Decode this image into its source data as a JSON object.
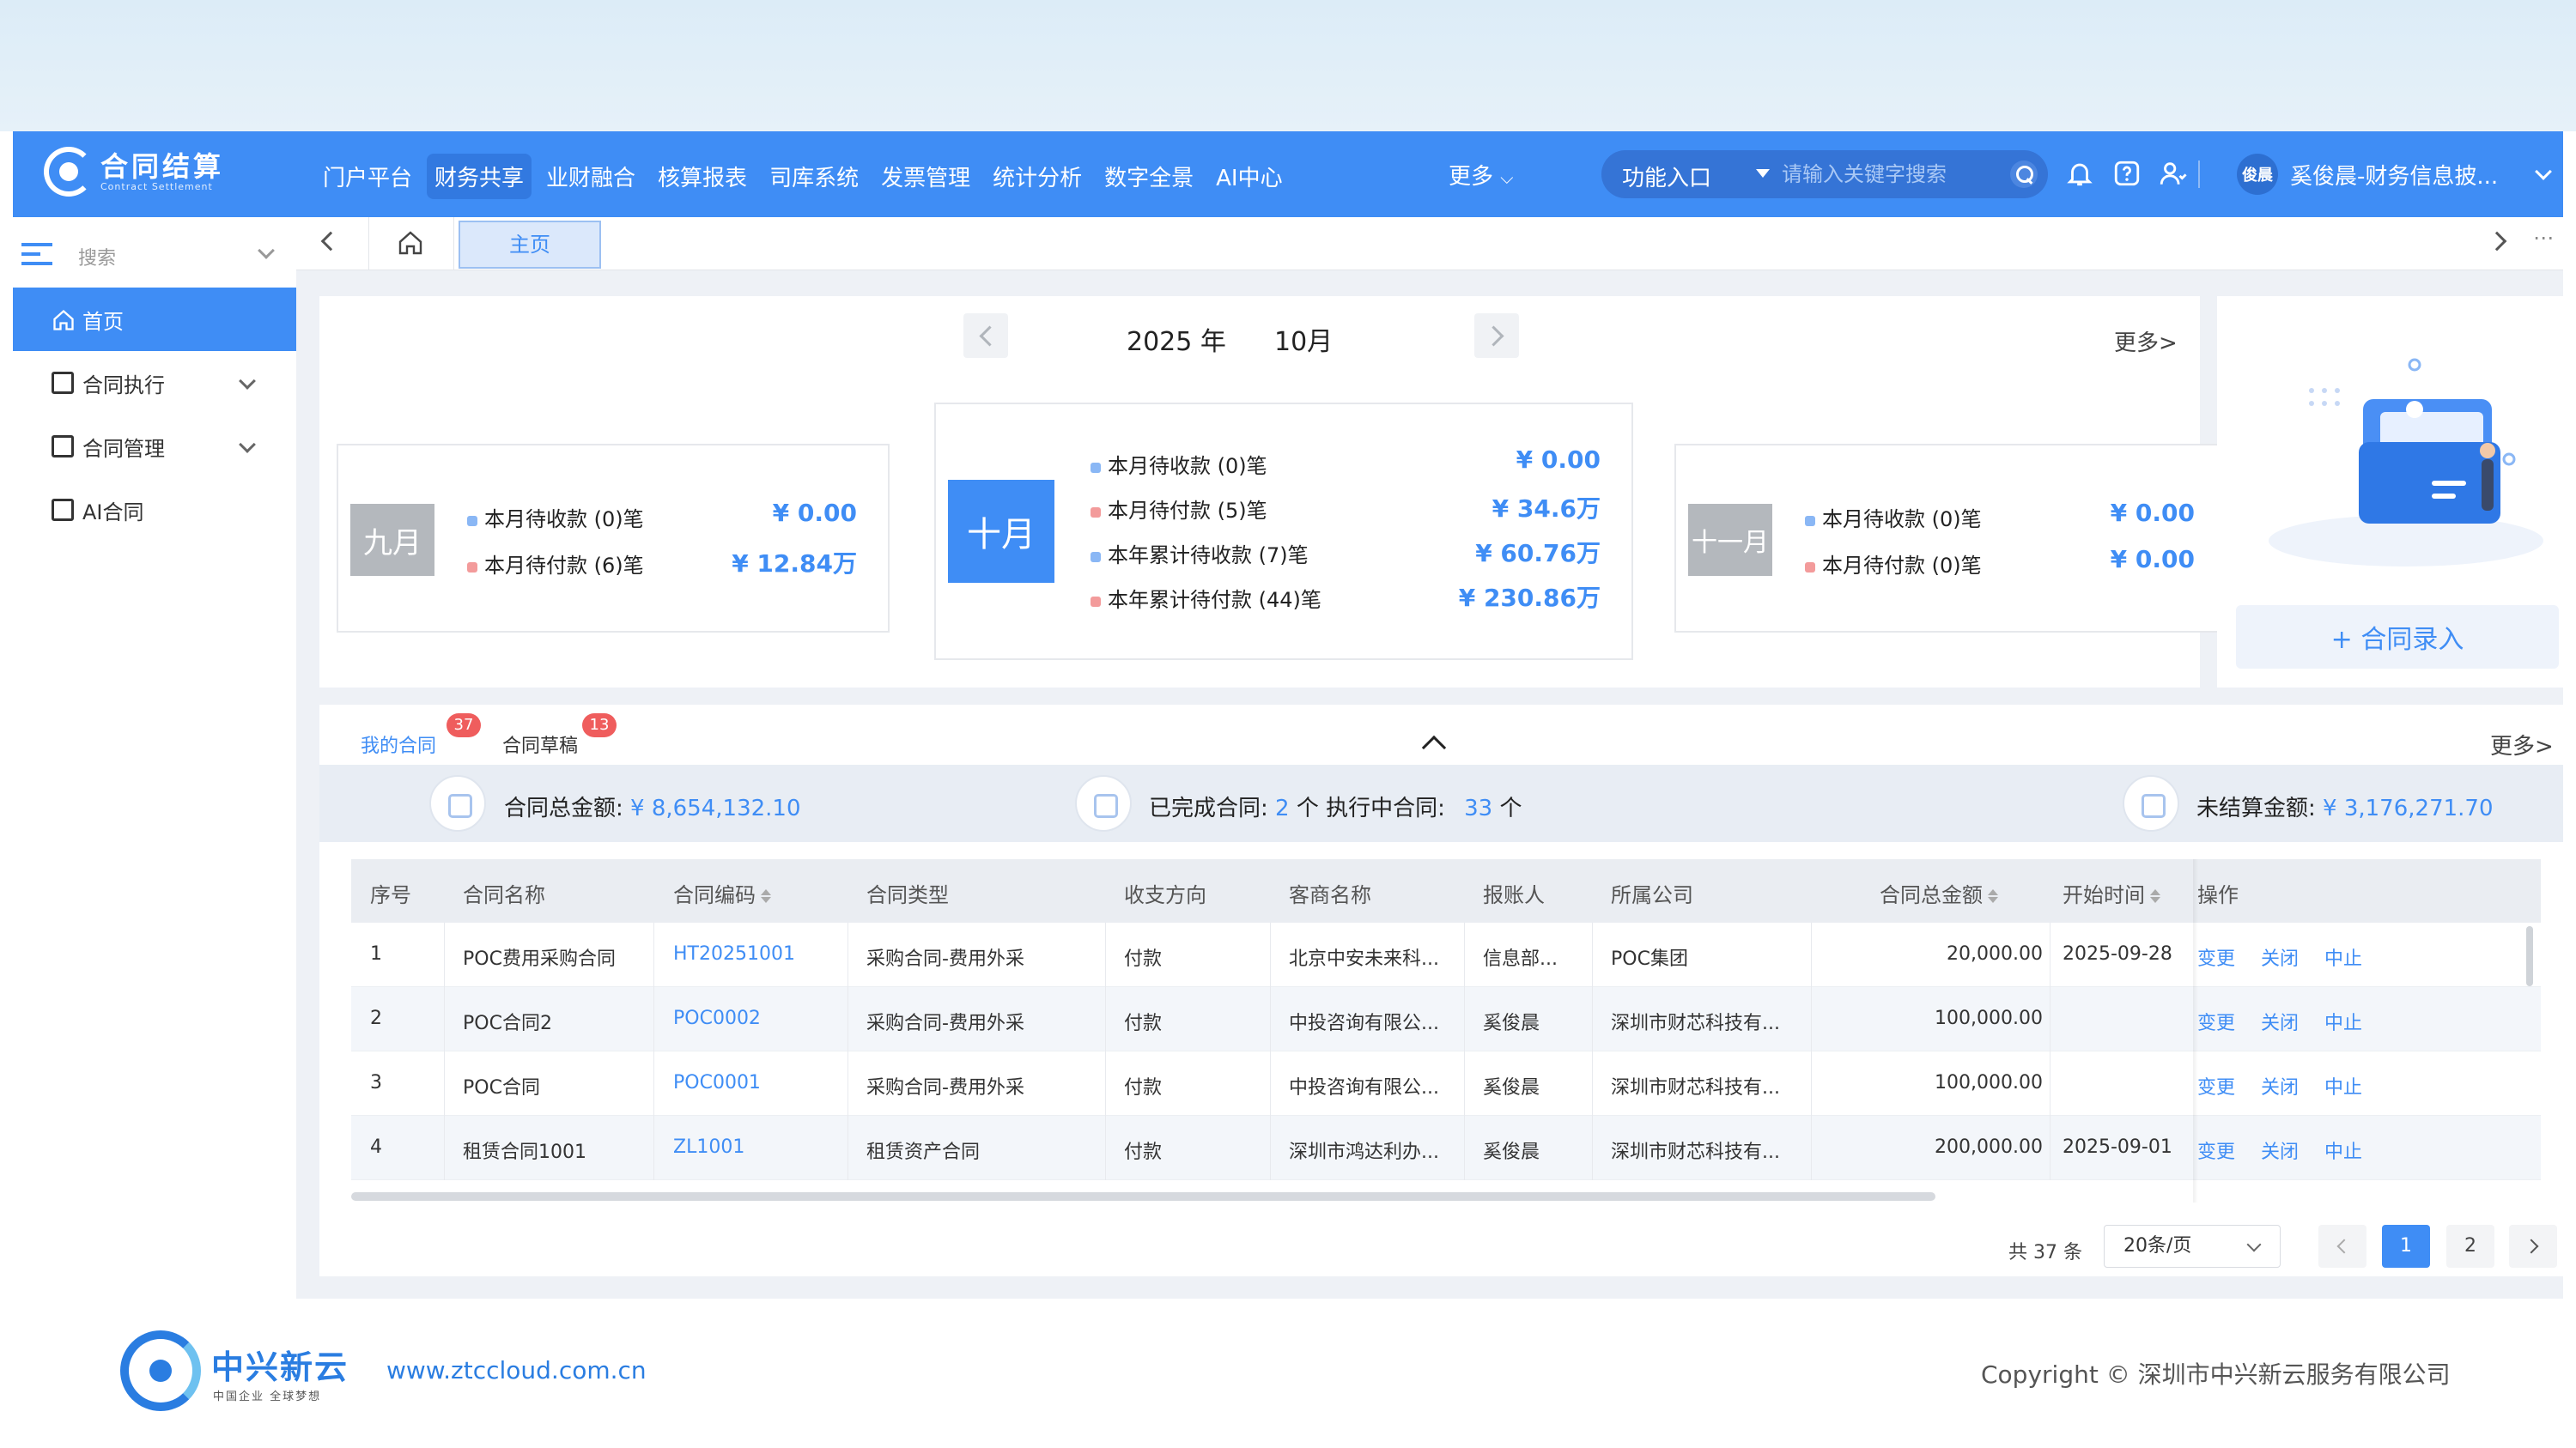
{
  "app": {
    "logo_cn": "合同结算",
    "logo_en": "Contract Settlement",
    "colors": {
      "primary": "#3f8df5",
      "badge": "#ef5d5d",
      "muted_month": "#b4b8bd"
    }
  },
  "header": {
    "nav": [
      "门户平台",
      "财务共享",
      "业财融合",
      "核算报表",
      "司库系统",
      "发票管理",
      "统计分析",
      "数字全景",
      "AI中心"
    ],
    "active_nav": "财务共享",
    "more": "更多",
    "func_label": "功能入口",
    "search_placeholder": "请输入关键字搜索",
    "avatar": "俊晨",
    "user": "奚俊晨-财务信息披..."
  },
  "sidebar": {
    "search_label": "搜索",
    "items": [
      {
        "label": "首页"
      },
      {
        "label": "合同执行"
      },
      {
        "label": "合同管理"
      },
      {
        "label": "AI合同"
      }
    ]
  },
  "tabs": {
    "main": "主页"
  },
  "calendar": {
    "year": "2025 年",
    "month": "10月",
    "more": "更多>",
    "prev_month": {
      "label": "九月",
      "rows": [
        {
          "text": "本月待收款 (0)笔",
          "value": "¥ 0.00"
        },
        {
          "text": "本月待付款 (6)笔",
          "value": "¥ 12.84万"
        }
      ]
    },
    "current_month": {
      "label": "十月",
      "rows": [
        {
          "text": "本月待收款 (0)笔",
          "value": "¥ 0.00"
        },
        {
          "text": "本月待付款 (5)笔",
          "value": "¥ 34.6万"
        },
        {
          "text": "本年累计待收款 (7)笔",
          "value": "¥ 60.76万"
        },
        {
          "text": "本年累计待付款 (44)笔",
          "value": "¥ 230.86万"
        }
      ]
    },
    "next_month": {
      "label": "十一月",
      "rows": [
        {
          "text": "本月待收款 (0)笔",
          "value": "¥ 0.00"
        },
        {
          "text": "本月待付款 (0)笔",
          "value": "¥ 0.00"
        }
      ]
    }
  },
  "promo": {
    "button": "+ 合同录入"
  },
  "contracts": {
    "tabs": [
      {
        "label": "我的合同",
        "count": "37"
      },
      {
        "label": "合同草稿",
        "count": "13"
      }
    ],
    "more": "更多>",
    "summary": {
      "total_label": "合同总金额:",
      "total_value": "¥ 8,654,132.10",
      "done_label": "已完成合同:",
      "done_value": "2",
      "done_unit": "个 执行中合同:",
      "exec_value": "33",
      "exec_unit": "个",
      "unsettled_label": "未结算金额:",
      "unsettled_value": "¥ 3,176,271.70"
    },
    "columns": [
      "序号",
      "合同名称",
      "合同编码",
      "合同类型",
      "收支方向",
      "客商名称",
      "报账人",
      "所属公司",
      "合同总金额",
      "开始时间",
      "操作"
    ],
    "rows": [
      {
        "no": "1",
        "name": "POC费用采购合同",
        "code": "HT20251001",
        "type": "采购合同-费用外采",
        "dir": "付款",
        "vendor": "北京中安未来科...",
        "reporter": "信息部...",
        "company": "POC集团",
        "amount": "20,000.00",
        "start": "2025-09-28"
      },
      {
        "no": "2",
        "name": "POC合同2",
        "code": "POC0002",
        "type": "采购合同-费用外采",
        "dir": "付款",
        "vendor": "中投咨询有限公...",
        "reporter": "奚俊晨",
        "company": "深圳市财芯科技有...",
        "amount": "100,000.00",
        "start": ""
      },
      {
        "no": "3",
        "name": "POC合同",
        "code": "POC0001",
        "type": "采购合同-费用外采",
        "dir": "付款",
        "vendor": "中投咨询有限公...",
        "reporter": "奚俊晨",
        "company": "深圳市财芯科技有...",
        "amount": "100,000.00",
        "start": ""
      },
      {
        "no": "4",
        "name": "租赁合同1001",
        "code": "ZL1001",
        "type": "租赁资产合同",
        "dir": "付款",
        "vendor": "深圳市鸿达利办...",
        "reporter": "奚俊晨",
        "company": "深圳市财芯科技有...",
        "amount": "200,000.00",
        "start": "2025-09-01"
      }
    ],
    "ops": [
      "变更",
      "关闭",
      "中止"
    ],
    "pager": {
      "total": "共 37 条",
      "size": "20条/页",
      "pages": [
        "1",
        "2"
      ]
    }
  },
  "footer": {
    "brand": "中兴新云",
    "tagline": "中国企业 全球梦想",
    "url": "www.ztccloud.com.cn",
    "copyright": "Copyright © 深圳市中兴新云服务有限公司"
  }
}
